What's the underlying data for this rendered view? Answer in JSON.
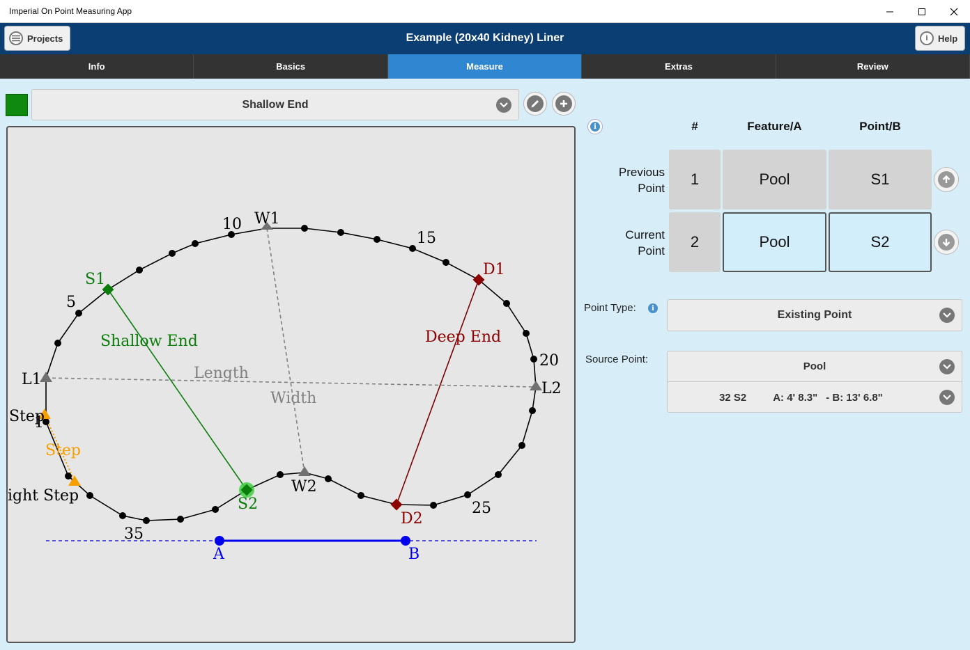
{
  "window": {
    "title": "Imperial On Point Measuring App"
  },
  "header": {
    "title": "Example (20x40 Kidney) Liner",
    "projects_label": "Projects",
    "help_label": "Help"
  },
  "tabs": [
    {
      "label": "Info",
      "active": false
    },
    {
      "label": "Basics",
      "active": false
    },
    {
      "label": "Measure",
      "active": true
    },
    {
      "label": "Extras",
      "active": false
    },
    {
      "label": "Review",
      "active": false
    }
  ],
  "feature": {
    "selected": "Shallow End",
    "color": "#0f8a0f"
  },
  "drawing": {
    "labels": {
      "n5": "5",
      "n10": "10",
      "n15": "15",
      "n20": "20",
      "n25": "25",
      "n35": "35",
      "W1": "W1",
      "W2": "W2",
      "S1": "S1",
      "S2": "S2",
      "D1": "D1",
      "D2": "D2",
      "L1": "L1",
      "L2": "L2",
      "A": "A",
      "B": "B",
      "shallow_end": "Shallow End",
      "deep_end": "Deep End",
      "length": "Length",
      "width": "Width",
      "step_left": "Step",
      "step_one": "1",
      "step_orange": "Step",
      "right_step": "ight Step"
    },
    "colors": {
      "shallow": "#0a7d0a",
      "deep": "#7a0000",
      "guide": "#808080",
      "step": "#f5a000",
      "ab": "#0000ee"
    }
  },
  "table": {
    "headers": {
      "num": "#",
      "feature": "Feature/A",
      "point": "Point/B"
    },
    "previous": {
      "label_line1": "Previous",
      "label_line2": "Point",
      "num": "1",
      "feature": "Pool",
      "point": "S1"
    },
    "current": {
      "label_line1": "Current",
      "label_line2": "Point",
      "num": "2",
      "feature": "Pool",
      "point": "S2"
    }
  },
  "point_type": {
    "label": "Point Type:",
    "value": "Existing Point"
  },
  "source_point": {
    "label": "Source Point:",
    "feature": "Pool",
    "point_id": "32 S2",
    "a_value": "A: 4' 8.3\"",
    "b_value": "- B: 13' 6.8\""
  }
}
